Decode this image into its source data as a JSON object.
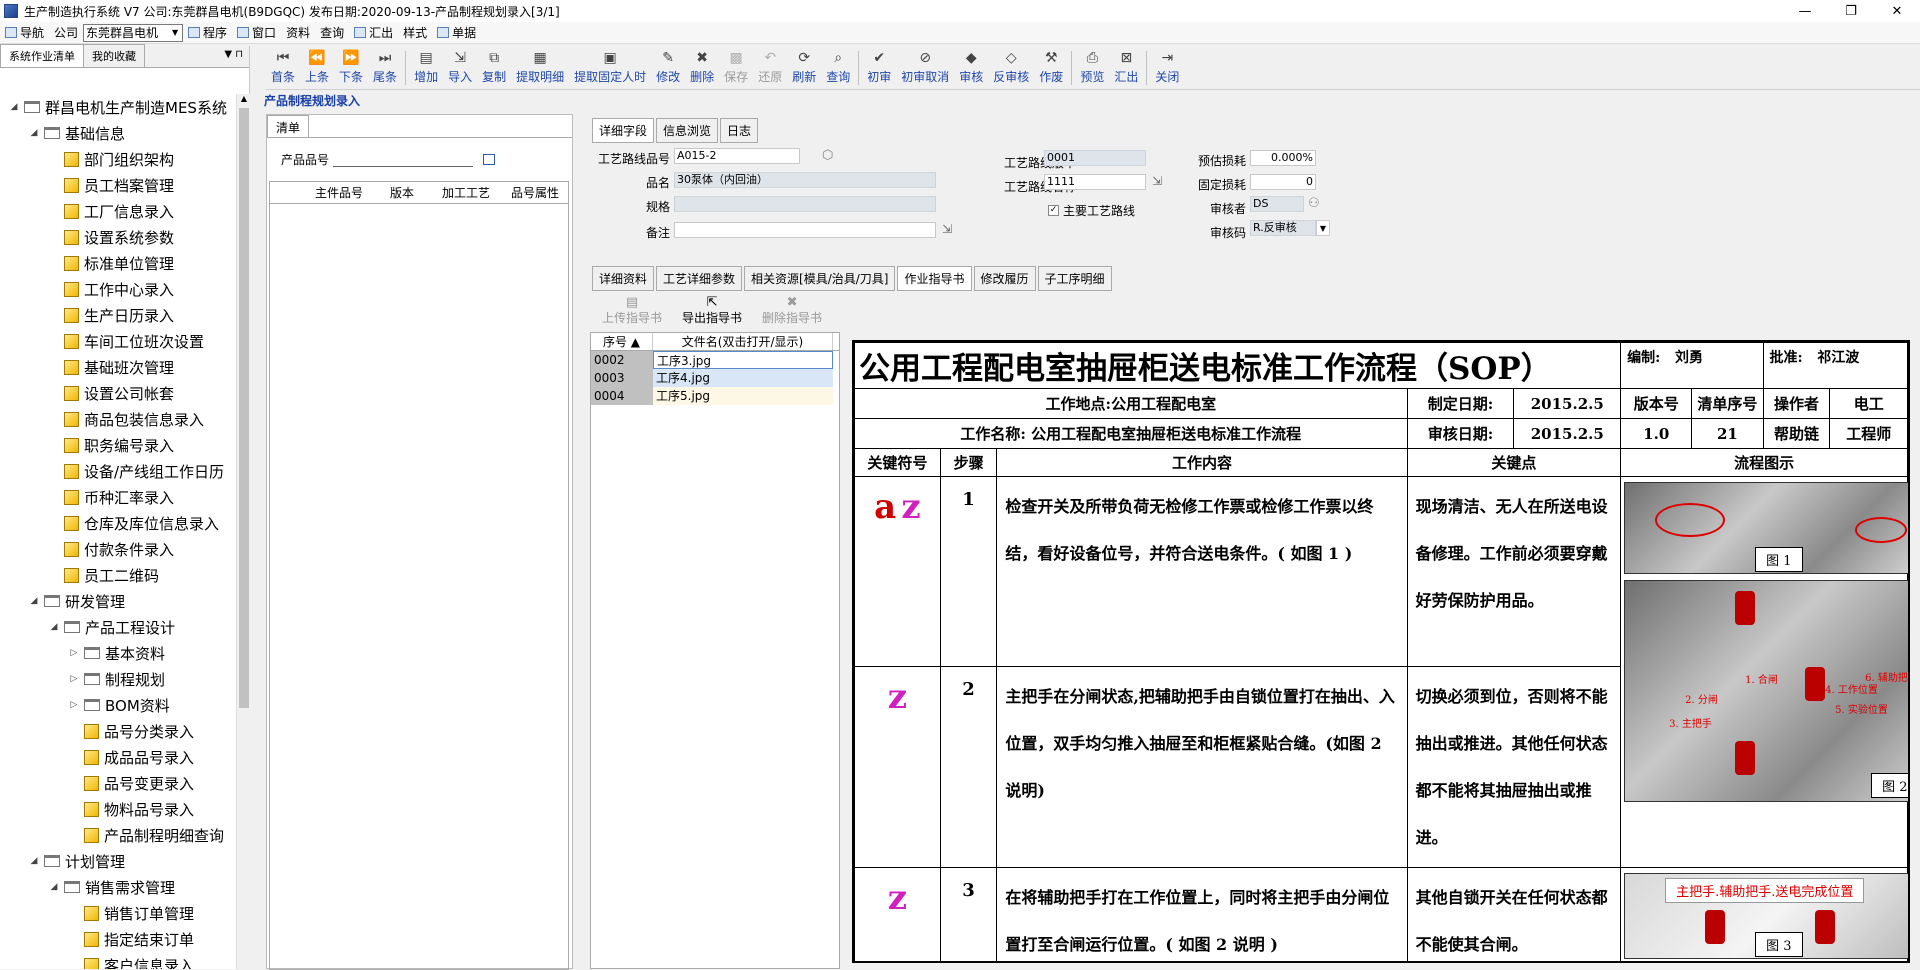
{
  "window": {
    "title": "生产制造执行系统 V7 公司:东莞群昌电机(B9DGQC) 发布日期:2020-09-13-产品制程规划录入[3/1]",
    "min": "—",
    "max": "❐",
    "close": "✕"
  },
  "menubar": {
    "items": [
      {
        "label": "导航"
      },
      {
        "label": "公司"
      }
    ],
    "company_combo": "东莞群昌电机",
    "items2": [
      {
        "label": "程序"
      },
      {
        "label": "窗口"
      },
      {
        "label": "资料"
      },
      {
        "label": "查询"
      },
      {
        "label": "汇出"
      },
      {
        "label": "样式"
      },
      {
        "label": "单据"
      }
    ]
  },
  "left": {
    "tabs": [
      "系统作业清单",
      "我的收藏"
    ],
    "pin": "▼ ⊓",
    "tree": [
      {
        "level": 0,
        "toggle": "◢",
        "icon": "folder",
        "label": "群昌电机生产制造MES系统"
      },
      {
        "level": 1,
        "toggle": "◢",
        "icon": "folder",
        "label": "基础信息"
      },
      {
        "level": 2,
        "toggle": "",
        "icon": "doc",
        "label": "部门组织架构"
      },
      {
        "level": 2,
        "toggle": "",
        "icon": "doc",
        "label": "员工档案管理"
      },
      {
        "level": 2,
        "toggle": "",
        "icon": "doc",
        "label": "工厂信息录入"
      },
      {
        "level": 2,
        "toggle": "",
        "icon": "doc",
        "label": "设置系统参数"
      },
      {
        "level": 2,
        "toggle": "",
        "icon": "doc",
        "label": "标准单位管理"
      },
      {
        "level": 2,
        "toggle": "",
        "icon": "doc",
        "label": "工作中心录入"
      },
      {
        "level": 2,
        "toggle": "",
        "icon": "doc",
        "label": "生产日历录入"
      },
      {
        "level": 2,
        "toggle": "",
        "icon": "doc",
        "label": "车间工位班次设置"
      },
      {
        "level": 2,
        "toggle": "",
        "icon": "doc",
        "label": "基础班次管理"
      },
      {
        "level": 2,
        "toggle": "",
        "icon": "doc",
        "label": "设置公司帐套"
      },
      {
        "level": 2,
        "toggle": "",
        "icon": "doc",
        "label": "商品包装信息录入"
      },
      {
        "level": 2,
        "toggle": "",
        "icon": "doc",
        "label": "职务编号录入"
      },
      {
        "level": 2,
        "toggle": "",
        "icon": "doc",
        "label": "设备/产线组工作日历"
      },
      {
        "level": 2,
        "toggle": "",
        "icon": "doc",
        "label": "币种汇率录入"
      },
      {
        "level": 2,
        "toggle": "",
        "icon": "doc",
        "label": "仓库及库位信息录入"
      },
      {
        "level": 2,
        "toggle": "",
        "icon": "doc",
        "label": "付款条件录入"
      },
      {
        "level": 2,
        "toggle": "",
        "icon": "doc",
        "label": "员工二维码"
      },
      {
        "level": 1,
        "toggle": "◢",
        "icon": "folder",
        "label": "研发管理"
      },
      {
        "level": 2,
        "toggle": "◢",
        "icon": "folder",
        "label": "产品工程设计"
      },
      {
        "level": 3,
        "toggle": "▷",
        "icon": "folder",
        "label": "基本资料"
      },
      {
        "level": 3,
        "toggle": "▷",
        "icon": "folder",
        "label": "制程规划"
      },
      {
        "level": 3,
        "toggle": "▷",
        "icon": "folder",
        "label": "BOM资料"
      },
      {
        "level": 3,
        "toggle": "",
        "icon": "doc",
        "label": "品号分类录入"
      },
      {
        "level": 3,
        "toggle": "",
        "icon": "doc",
        "label": "成品品号录入"
      },
      {
        "level": 3,
        "toggle": "",
        "icon": "doc",
        "label": "品号变更录入"
      },
      {
        "level": 3,
        "toggle": "",
        "icon": "doc",
        "label": "物料品号录入"
      },
      {
        "level": 3,
        "toggle": "",
        "icon": "doc",
        "label": "产品制程明细查询"
      },
      {
        "level": 1,
        "toggle": "◢",
        "icon": "folder",
        "label": "计划管理"
      },
      {
        "level": 2,
        "toggle": "◢",
        "icon": "folder",
        "label": "销售需求管理"
      },
      {
        "level": 3,
        "toggle": "",
        "icon": "doc",
        "label": "销售订单管理"
      },
      {
        "level": 3,
        "toggle": "",
        "icon": "doc",
        "label": "指定结束订单"
      },
      {
        "level": 3,
        "toggle": "",
        "icon": "doc",
        "label": "客户信息录入"
      }
    ]
  },
  "toolbar": [
    {
      "label": "首条",
      "icon": "⏮",
      "dis": false
    },
    {
      "label": "上条",
      "icon": "⏪",
      "dis": false
    },
    {
      "label": "下条",
      "icon": "⏩",
      "dis": false
    },
    {
      "label": "尾条",
      "icon": "⏭",
      "dis": false
    },
    {
      "sep": true
    },
    {
      "label": "增加",
      "icon": "▤",
      "dis": false
    },
    {
      "label": "导入",
      "icon": "⇲",
      "dis": false
    },
    {
      "label": "复制",
      "icon": "⧉",
      "dis": false
    },
    {
      "label": "提取明细",
      "icon": "▦",
      "dis": false
    },
    {
      "label": "提取固定人时",
      "icon": "▣",
      "dis": false
    },
    {
      "label": "修改",
      "icon": "✎",
      "dis": false
    },
    {
      "label": "删除",
      "icon": "✖",
      "dis": false
    },
    {
      "label": "保存",
      "icon": "▩",
      "dis": true
    },
    {
      "label": "还原",
      "icon": "↶",
      "dis": true
    },
    {
      "label": "刷新",
      "icon": "⟳",
      "dis": false
    },
    {
      "label": "查询",
      "icon": "⌕",
      "dis": false
    },
    {
      "sep": true
    },
    {
      "label": "初审",
      "icon": "✔",
      "dis": false
    },
    {
      "label": "初审取消",
      "icon": "⊘",
      "dis": false
    },
    {
      "label": "审核",
      "icon": "◆",
      "dis": false
    },
    {
      "label": "反审核",
      "icon": "◇",
      "dis": false
    },
    {
      "label": "作废",
      "icon": "⚒",
      "dis": false
    },
    {
      "sep": true
    },
    {
      "label": "预览",
      "icon": "⎙",
      "dis": false
    },
    {
      "label": "汇出",
      "icon": "⊠",
      "dis": false
    },
    {
      "sep": true
    },
    {
      "label": "关闭",
      "icon": "⇥",
      "dis": false
    }
  ],
  "page_title": "产品制程规划录入",
  "list_panel": {
    "tab": "清单",
    "field_label": "产品品号",
    "columns": [
      "主件品号",
      "版本",
      "加工工艺",
      "品号属性"
    ]
  },
  "detail_tabs": [
    "详细字段",
    "信息浏览",
    "日志"
  ],
  "form": {
    "route_no_label": "工艺路线品号",
    "route_no": "A015-2",
    "name_label": "品名",
    "name": "30泵体（内回油）",
    "spec_label": "规格",
    "spec": "",
    "remark_label": "备注",
    "remark": "",
    "version_label": "工艺路线版本",
    "version": "0001",
    "route_name_label": "工艺路线名称",
    "route_name": "1111",
    "main_route_label": "主要工艺路线",
    "main_route_checked": "✓",
    "loss_label": "预估损耗",
    "loss": "0.000%",
    "fixed_loss_label": "固定损耗",
    "fixed_loss": "0",
    "auditor_label": "审核者",
    "auditor": "DS",
    "audit_code_label": "审核码",
    "audit_code": "R.反审核"
  },
  "sub_tabs": [
    "详细资料",
    "工艺详细参数",
    "相关资源[模具/治具/刀具]",
    "作业指导书",
    "修改履历",
    "子工序明细"
  ],
  "sub_toolbar": [
    {
      "label": "上传指导书",
      "icon": "▤",
      "dis": true
    },
    {
      "label": "导出指导书",
      "icon": "⇱",
      "dis": false
    },
    {
      "label": "删除指导书",
      "icon": "✖",
      "dis": true
    }
  ],
  "file_grid": {
    "col_seq": "序号 ▲",
    "col_file": "文件名(双击打开/显示)",
    "rows": [
      {
        "seq": "0002",
        "file": "工序3.jpg"
      },
      {
        "seq": "0003",
        "file": "工序4.jpg"
      },
      {
        "seq": "0004",
        "file": "工序5.jpg"
      }
    ]
  },
  "sop": {
    "title": "公用工程配电室抽屉柜送电标准工作流程（SOP）",
    "editor_label": "编制:",
    "editor": "刘勇",
    "approver_label": "批准:",
    "approver": "祁江波",
    "location": "工作地点:公用工程配电室",
    "set_date_label": "制定日期:",
    "set_date": "2015.2.5",
    "version_label": "版本号",
    "list_no_label": "清单序号",
    "operator_label": "操作者",
    "operator": "电工",
    "work_name": "工作名称: 公用工程配电室抽屉柜送电标准工作流程",
    "audit_date_label": "审核日期:",
    "audit_date": "2015.2.5",
    "version": "1.0",
    "list_no": "21",
    "helper": "帮助链",
    "engineer": "工程师",
    "h_symbol": "关键符号",
    "h_step": "步骤",
    "h_content": "工作内容",
    "h_key": "关键点",
    "h_flow": "流程图示",
    "steps": [
      {
        "sym_a": "a",
        "sym_z": "z",
        "step": "1",
        "content": "检查开关及所带负荷无检修工作票或检修工作票以终结，看好设备位号，并符合送电条件。( 如图 1 )",
        "key": "现场清洁、无人在所送电设备修理。工作前必须要穿戴好劳保防护用品。"
      },
      {
        "sym_a": "",
        "sym_z": "z",
        "step": "2",
        "content": "主把手在分闸状态,把辅助把手由自锁位置打在抽出、入位置，双手均匀推入抽屉至和柜框紧贴合缝。(如图 2 说明)",
        "key": "切换必须到位，否则将不能抽出或推进。其他任何状态都不能将其抽屉抽出或推进。"
      },
      {
        "sym_a": "",
        "sym_z": "z",
        "step": "3",
        "content": "在将辅助把手打在工作位置上，同时将主把手由分闸位置打至合闸运行位置。( 如图 2 说明 )",
        "key": "其他自锁开关在任何状态都不能使其合闸。"
      }
    ],
    "fig1": "图 1",
    "fig2": "图 2",
    "fig3": "图 3",
    "fig3_banner": "主把手.辅助把手.送电完成位置",
    "fig2_notes": [
      "1. 合闸",
      "2. 分闸",
      "3. 主把手",
      "4. 工作位置",
      "5. 实验位置",
      "6. 辅助把手"
    ]
  },
  "colors": {
    "accent": "#1a3fa8",
    "symbol_red": "#d00000",
    "symbol_magenta": "#d020c0"
  }
}
